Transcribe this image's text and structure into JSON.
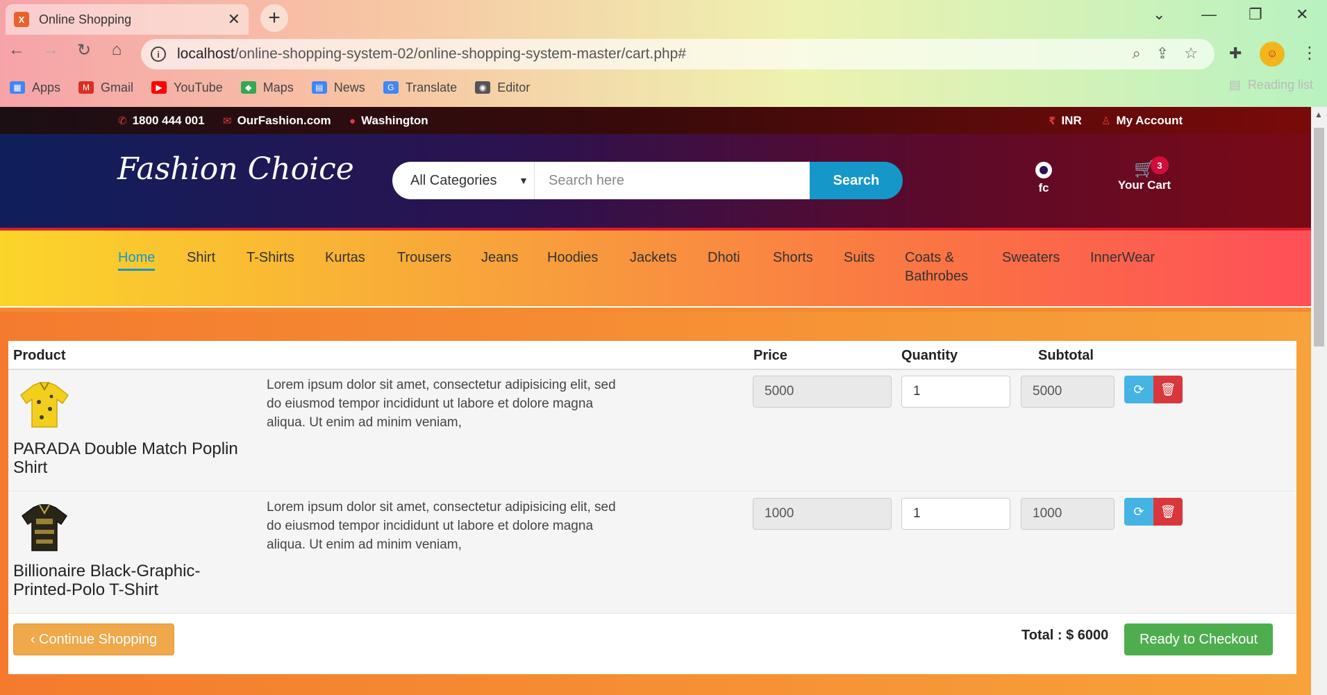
{
  "browser": {
    "tab_title": "Online Shopping",
    "url_host": "localhost",
    "url_path": "/online-shopping-system-02/online-shopping-system-master/cart.php#",
    "bookmarks": [
      {
        "label": "Apps",
        "icon": "apps-grid-icon",
        "color": "#4285f4"
      },
      {
        "label": "Gmail",
        "icon": "gmail-icon",
        "color": "#d93025"
      },
      {
        "label": "YouTube",
        "icon": "youtube-icon",
        "color": "#ff0000"
      },
      {
        "label": "Maps",
        "icon": "maps-icon",
        "color": "#34a853"
      },
      {
        "label": "News",
        "icon": "news-icon",
        "color": "#4285f4"
      },
      {
        "label": "Translate",
        "icon": "translate-icon",
        "color": "#4285f4"
      },
      {
        "label": "Editor",
        "icon": "editor-globe-icon",
        "color": "#555555"
      }
    ],
    "reading_list": "Reading list"
  },
  "topbar": {
    "phone": "1800 444 001",
    "email": "OurFashion.com",
    "location": "Washington",
    "currency": "INR",
    "account": "My Account"
  },
  "header": {
    "logo": "Fashion Choice",
    "category_select": "All Categories",
    "search_placeholder": "Search here",
    "search_button": "Search",
    "github_label": "fc",
    "cart_label": "Your Cart",
    "cart_count": "3"
  },
  "nav": {
    "items": [
      "Home",
      "Shirt",
      "T-Shirts",
      "Kurtas",
      "Trousers",
      "Jeans",
      "Hoodies",
      "Jackets",
      "Dhoti",
      "Shorts",
      "Suits",
      "Coats &",
      "Sweaters",
      "InnerWear"
    ],
    "coats_line2": "Bathrobes"
  },
  "cart": {
    "headers": {
      "product": "Product",
      "price": "Price",
      "quantity": "Quantity",
      "subtotal": "Subtotal"
    },
    "items": [
      {
        "name": "PARADA Double Match Poplin Shirt",
        "description": "Lorem ipsum dolor sit amet, consectetur adipisicing elit, sed do eiusmod tempor incididunt ut labore et dolore magna aliqua. Ut enim ad minim veniam,",
        "price": "5000",
        "quantity": "1",
        "subtotal": "5000"
      },
      {
        "name": "Billionaire Black-Graphic-Printed-Polo T-Shirt",
        "description": "Lorem ipsum dolor sit amet, consectetur adipisicing elit, sed do eiusmod tempor incididunt ut labore et dolore magna aliqua. Ut enim ad minim veniam,",
        "price": "1000",
        "quantity": "1",
        "subtotal": "1000"
      }
    ],
    "continue_label": "‹ Continue Shopping",
    "total_label": "Total : $ 6000",
    "checkout_label": "Ready to Checkout"
  },
  "colors": {
    "accent_blue": "#1597c9",
    "checkout_green": "#4eae4e",
    "continue_orange": "#efa84a",
    "delete_red": "#d9373b",
    "refresh_blue": "#45b4e4"
  }
}
